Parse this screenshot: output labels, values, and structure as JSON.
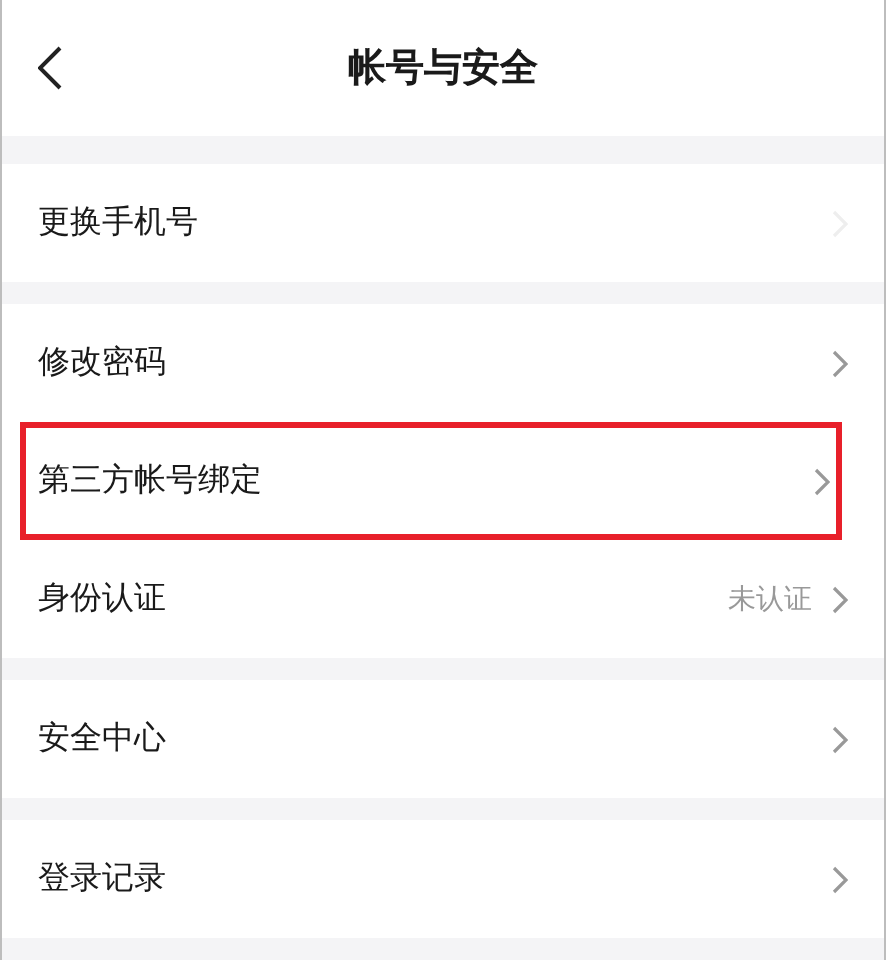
{
  "header": {
    "title": "帐号与安全"
  },
  "groups": [
    {
      "rows": [
        {
          "label": "更换手机号",
          "dimmed": true,
          "highlighted": false
        }
      ]
    },
    {
      "rows": [
        {
          "label": "修改密码",
          "dimmed": false,
          "highlighted": false
        },
        {
          "label": "第三方帐号绑定",
          "dimmed": false,
          "highlighted": true
        },
        {
          "label": "身份认证",
          "value": "未认证",
          "dimmed": false,
          "highlighted": false
        }
      ]
    },
    {
      "rows": [
        {
          "label": "安全中心",
          "dimmed": false,
          "highlighted": false
        }
      ]
    },
    {
      "rows": [
        {
          "label": "登录记录",
          "dimmed": false,
          "highlighted": false
        }
      ]
    }
  ]
}
